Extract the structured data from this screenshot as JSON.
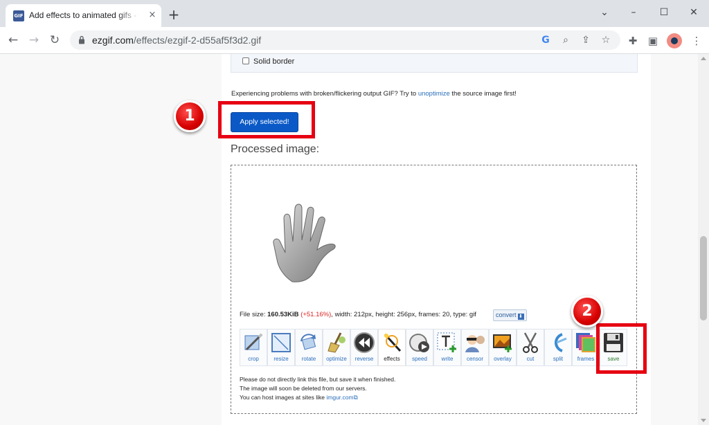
{
  "browser": {
    "tab_title": "Add effects to animated gifs - wa",
    "tab_close": "×",
    "new_tab": "+",
    "url_host": "ezgif.com",
    "url_path": "/effects/ezgif-2-d55af5f3d2.gif",
    "favicon_text": "GIF",
    "window_controls": {
      "collapse": "⌄",
      "minimize": "–",
      "maximize": "☐",
      "close": "✕"
    },
    "nav": {
      "back": "←",
      "forward": "→",
      "reload": "↻"
    },
    "omnibox_icons": {
      "google": "G",
      "zoom": "⌕",
      "share": "⇪",
      "bookmark": "☆"
    },
    "toolbar_icons": {
      "extensions": "✚",
      "sidebar": "▣",
      "menu": "⋮"
    }
  },
  "options": {
    "solid_border_label": "Solid border",
    "solid_border_checked": false
  },
  "warning": {
    "before": "Experiencing problems with broken/flickering output GIF? Try to ",
    "link": "unoptimize",
    "after": " the source image first!"
  },
  "apply_button": "Apply selected!",
  "processed_title": "Processed image:",
  "file_info": {
    "prefix": "File size: ",
    "size": "160.53KiB",
    "change": "(+51.16%)",
    "rest": ", width: 212px, height: 256px, frames: 20, type: gif",
    "convert_label": "convert",
    "convert_icon": "⬇"
  },
  "tools": [
    "crop",
    "resize",
    "rotate",
    "optimize",
    "reverse",
    "effects",
    "speed",
    "write",
    "censor",
    "overlay",
    "cut",
    "split",
    "frames",
    "save"
  ],
  "notes": {
    "line1": "Please do not directly link this file, but save it when finished.",
    "line2": "The image will soon be deleted from our servers.",
    "line3_before": "You can host images at sites like ",
    "line3_link": "imgur.com",
    "line3_link_icon": "⧉"
  },
  "annotations": {
    "badge1": "1",
    "badge2": "2"
  },
  "colors": {
    "accent": "#0a59c7",
    "annotation": "#e60012",
    "link": "#2a6ebb"
  }
}
